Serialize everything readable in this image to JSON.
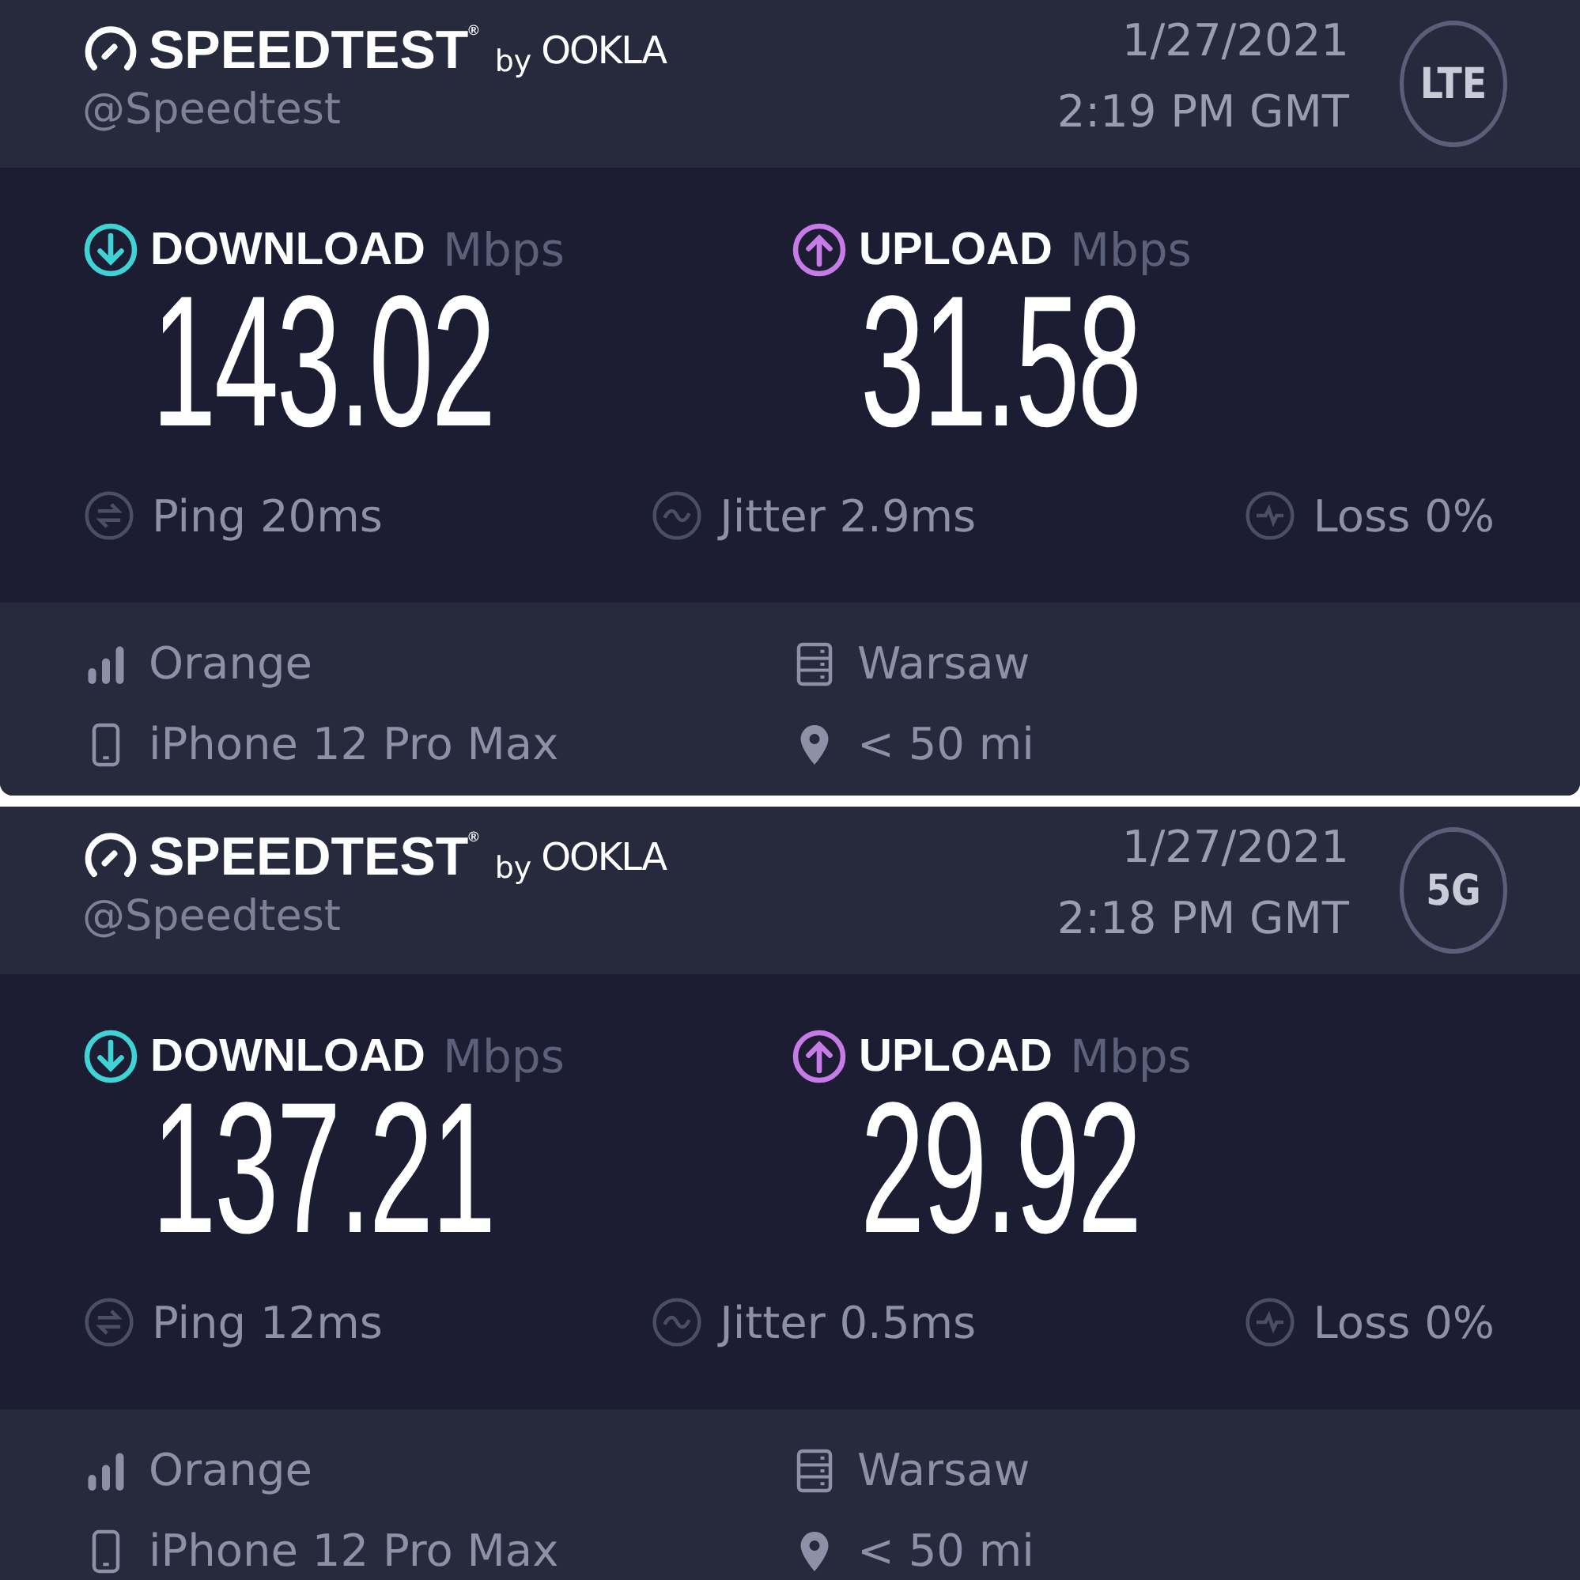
{
  "cards": [
    {
      "logo": {
        "name": "SPEEDTEST$^{®}$",
        "by": "by",
        "brand": "OOKLA"
      },
      "handle": "@Speedtest",
      "date": "1/27/2021",
      "time": "2:19 PM GMT",
      "network": "LTE",
      "results": [
        {
          "kind": "download",
          "label": "DOWNLOAD",
          "unit": "Mbps",
          "value": "143.02"
        },
        {
          "kind": "upload",
          "label": "UPLOAD",
          "unit": "Mbps",
          "value": "31.58"
        }
      ],
      "metrics": [
        {
          "kind": "ping",
          "text": "Ping 20ms"
        },
        {
          "kind": "jitter",
          "text": "Jitter 2.9ms"
        },
        {
          "kind": "loss",
          "text": "Loss 0%"
        }
      ],
      "details": [
        {
          "kind": "carrier",
          "text": "Orange"
        },
        {
          "kind": "server",
          "text": "Warsaw"
        },
        {
          "kind": "device",
          "text": "iPhone 12 Pro Max"
        },
        {
          "kind": "distance",
          "text": "< 50 mi"
        }
      ]
    },
    {
      "logo": {
        "name": "SPEEDTEST$^{®}$",
        "by": "by",
        "brand": "OOKLA"
      },
      "handle": "@Speedtest",
      "date": "1/27/2021",
      "time": "2:18 PM GMT",
      "network": "5G",
      "results": [
        {
          "kind": "download",
          "label": "DOWNLOAD",
          "unit": "Mbps",
          "value": "137.21"
        },
        {
          "kind": "upload",
          "label": "UPLOAD",
          "unit": "Mbps",
          "value": "29.92"
        }
      ],
      "metrics": [
        {
          "kind": "ping",
          "text": "Ping 12ms"
        },
        {
          "kind": "jitter",
          "text": "Jitter 0.5ms"
        },
        {
          "kind": "loss",
          "text": "Loss 0%"
        }
      ],
      "details": [
        {
          "kind": "carrier",
          "text": "Orange"
        },
        {
          "kind": "server",
          "text": "Warsaw"
        },
        {
          "kind": "device",
          "text": "iPhone 12 Pro Max"
        },
        {
          "kind": "distance",
          "text": "< 50 mi"
        }
      ]
    }
  ]
}
